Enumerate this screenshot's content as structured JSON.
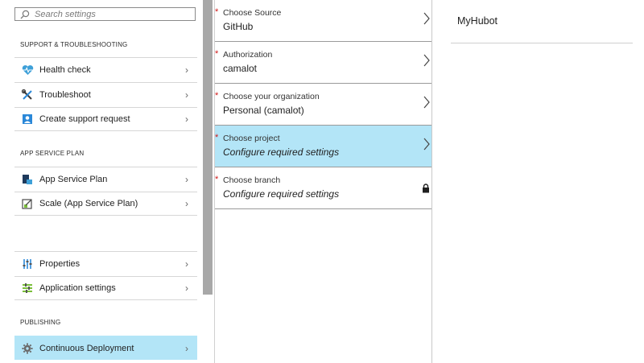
{
  "search": {
    "placeholder": "Search settings",
    "icon": "search-icon"
  },
  "sections": {
    "support": {
      "title": "SUPPORT & TROUBLESHOOTING",
      "items": [
        {
          "label": "Health check",
          "icon": "heart-monitor-icon"
        },
        {
          "label": "Troubleshoot",
          "icon": "tools-icon"
        },
        {
          "label": "Create support request",
          "icon": "support-person-icon"
        }
      ]
    },
    "app_service_plan": {
      "title": "APP SERVICE PLAN",
      "items": [
        {
          "label": "App Service Plan",
          "icon": "app-service-plan-icon"
        },
        {
          "label": "Scale (App Service Plan)",
          "icon": "scale-icon"
        }
      ]
    },
    "general": {
      "items": [
        {
          "label": "Properties",
          "icon": "properties-sliders-icon"
        },
        {
          "label": "Application settings",
          "icon": "application-settings-icon"
        }
      ]
    },
    "publishing": {
      "title": "PUBLISHING",
      "items": [
        {
          "label": "Continuous Deployment",
          "icon": "gear-icon",
          "selected": true
        }
      ]
    }
  },
  "deployment": {
    "fields": [
      {
        "label": "Choose Source",
        "value": "GitHub",
        "required_mark": "*"
      },
      {
        "label": "Authorization",
        "value": "camalot",
        "required_mark": "*"
      },
      {
        "label": "Choose your organization",
        "value": "Personal (camalot)",
        "required_mark": "*"
      },
      {
        "label": "Choose project",
        "value": "Configure required settings",
        "required_mark": "*",
        "selected": true
      },
      {
        "label": "Choose branch",
        "value": "Configure required settings",
        "required_mark": "*",
        "locked": true
      }
    ]
  },
  "right_pane": {
    "title": "MyHubot"
  },
  "colors": {
    "selected_bg": "#b3e5f7",
    "required": "#d01818",
    "accent": "#2b88d8"
  }
}
